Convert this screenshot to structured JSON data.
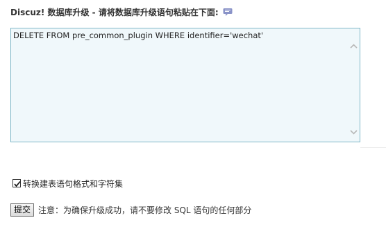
{
  "header": {
    "title": "Discuz! 数据库升级 - 请将数据库升级语句粘贴在下面:",
    "help_icon": "speech-bubble-icon"
  },
  "sql_input": {
    "value": "DELETE FROM pre_common_plugin WHERE identifier='wechat'"
  },
  "options": {
    "convert_label": "转换建表语句格式和字符集",
    "convert_checked": true
  },
  "submit": {
    "button_label": "提交",
    "notice": "注意：为确保升级成功，请不要修改 SQL 语句的任何部分"
  },
  "colors": {
    "textarea_border": "#7fb7c7",
    "textarea_bg": "#f0f8fb",
    "help_icon": "#8a93c8"
  }
}
